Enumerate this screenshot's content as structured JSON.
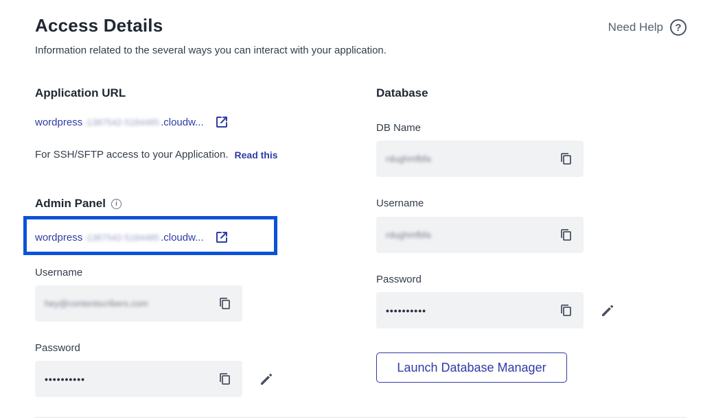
{
  "header": {
    "title": "Access Details",
    "subtitle": "Information related to the several ways you can interact with your application.",
    "help_label": "Need Help",
    "help_icon": "?"
  },
  "app_url": {
    "title": "Application URL",
    "link_prefix": "wordpress",
    "link_hidden": "-1387542-5184485",
    "link_suffix": ".cloudw...",
    "ssh_text": "For SSH/SFTP access to your Application.",
    "read_link": "Read this"
  },
  "admin": {
    "title": "Admin Panel",
    "info_icon": "i",
    "link_prefix": "wordpress",
    "link_hidden": "-1387542-5184485",
    "link_suffix": ".cloudw...",
    "username_label": "Username",
    "username_value": "hey@contentscribers.com",
    "password_label": "Password",
    "password_value": "••••••••••"
  },
  "database": {
    "title": "Database",
    "dbname_label": "DB Name",
    "dbname_value": "rdughmfbfa",
    "username_label": "Username",
    "username_value": "rdughmfbfa",
    "password_label": "Password",
    "password_value": "••••••••••",
    "launch_label": "Launch Database Manager"
  },
  "colors": {
    "link": "#2e3ba6",
    "highlight": "#0c52d9",
    "field_bg": "#f1f2f4"
  }
}
